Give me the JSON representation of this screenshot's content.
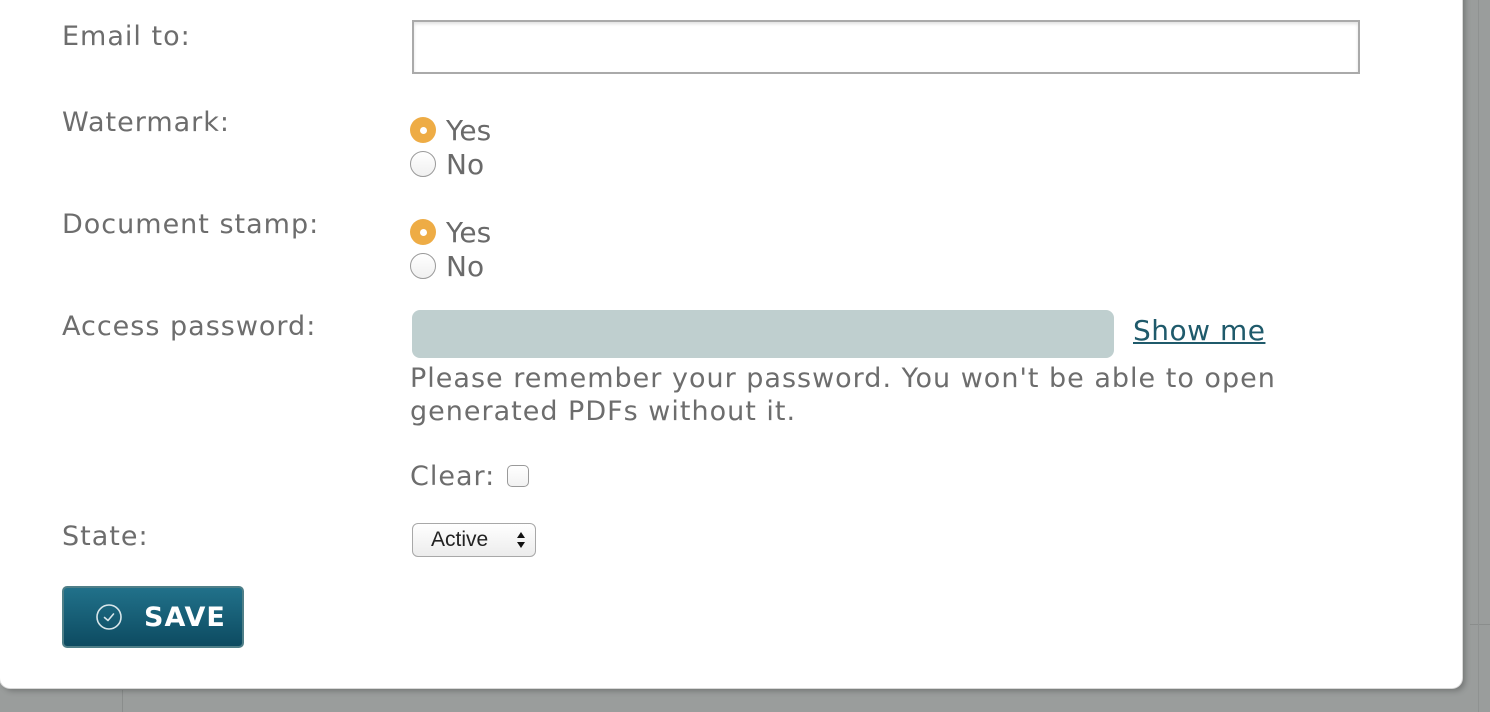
{
  "form": {
    "email": {
      "label": "Email to:",
      "value": "",
      "placeholder": ""
    },
    "watermark": {
      "label": "Watermark:",
      "options": [
        {
          "label": "Yes",
          "checked": true
        },
        {
          "label": "No",
          "checked": false
        }
      ]
    },
    "document_stamp": {
      "label": "Document stamp:",
      "options": [
        {
          "label": "Yes",
          "checked": true
        },
        {
          "label": "No",
          "checked": false
        }
      ]
    },
    "access_password": {
      "label": "Access password:",
      "show_link": "Show me",
      "hint": "Please remember your password. You won't be able to open generated PDFs without it."
    },
    "clear": {
      "label": "Clear:",
      "checked": false
    },
    "state": {
      "label": "State:",
      "selected": "Active"
    },
    "save_button": {
      "label": "SAVE",
      "icon": "check-circle-icon"
    }
  },
  "colors": {
    "radio_checked": "#eeac45",
    "button_bg": "#0d4b61",
    "link": "#1f5a6b",
    "password_field_bg": "#bfcfcf"
  }
}
